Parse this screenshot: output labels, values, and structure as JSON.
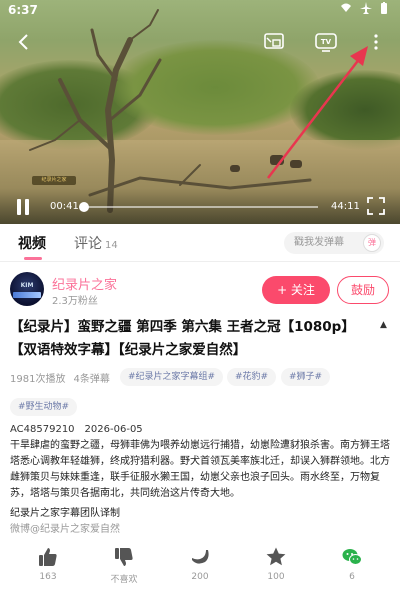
{
  "status_bar": {
    "time": "6:37",
    "right_icons": [
      "wifi-icon",
      "airplane-icon",
      "battery-icon"
    ]
  },
  "player": {
    "current_time": "00:41",
    "duration": "44:11",
    "progress": 0.0155,
    "watermark": "纪录片之家",
    "icons": [
      "back-icon",
      "cast-icon",
      "tv-icon",
      "more-icon",
      "pause-icon",
      "fullscreen-icon"
    ]
  },
  "tabs": {
    "video": "视频",
    "comment": "评论",
    "comment_count": "14"
  },
  "danmaku": {
    "placeholder": "戳我发弹幕",
    "toggle": "弹"
  },
  "uploader": {
    "avatar_text": "KIM",
    "name": "纪录片之家",
    "fans": "2.3万粉丝",
    "follow": "+ 关注",
    "tip": "鼓励"
  },
  "video_info": {
    "title": "【纪录片】蛮野之疆 第四季 第六集 王者之冠【1080p】【双语特效字幕】【纪录片之家爱自然】",
    "plays": "1981次播放",
    "danmaku_count": "4条弹幕",
    "tags": [
      "#纪录片之家字幕组#",
      "#花豹#",
      "#狮子#",
      "#野生动物#"
    ],
    "av": "AC48579210",
    "date": "2026-06-05",
    "description": "干旱肆虐的蛮野之疆，母狮菲佛为喂养幼崽远行捕猎，幼崽险遭豺狼杀害。南方狮王塔塔悉心调教年轻雄狮，终成狩猎利器。野犬首领瓦美率族北迁，却误入狮群领地。北方雌狮策贝与妹妹重逢，联手征服水獭王国，幼崽父亲也浪子回头。雨水终至，万物复苏，塔塔与策贝各据南北，共同统治这片传奇大地。",
    "team": "纪录片之家字幕团队译制",
    "weibo": "微博@纪录片之家爱自然"
  },
  "actions": [
    {
      "icon": "thumb-up-icon",
      "label": "163"
    },
    {
      "icon": "thumb-down-icon",
      "label": "不喜欢"
    },
    {
      "icon": "banana-icon",
      "label": "200"
    },
    {
      "icon": "star-icon",
      "label": "100"
    },
    {
      "icon": "wechat-icon",
      "label": "6"
    }
  ],
  "colors": {
    "accent": "#fb7299",
    "follow": "#fb4a6c",
    "tag_text": "#6c7aa8",
    "annotation_arrow": "#e8364f",
    "wechat": "#2bb24c"
  }
}
